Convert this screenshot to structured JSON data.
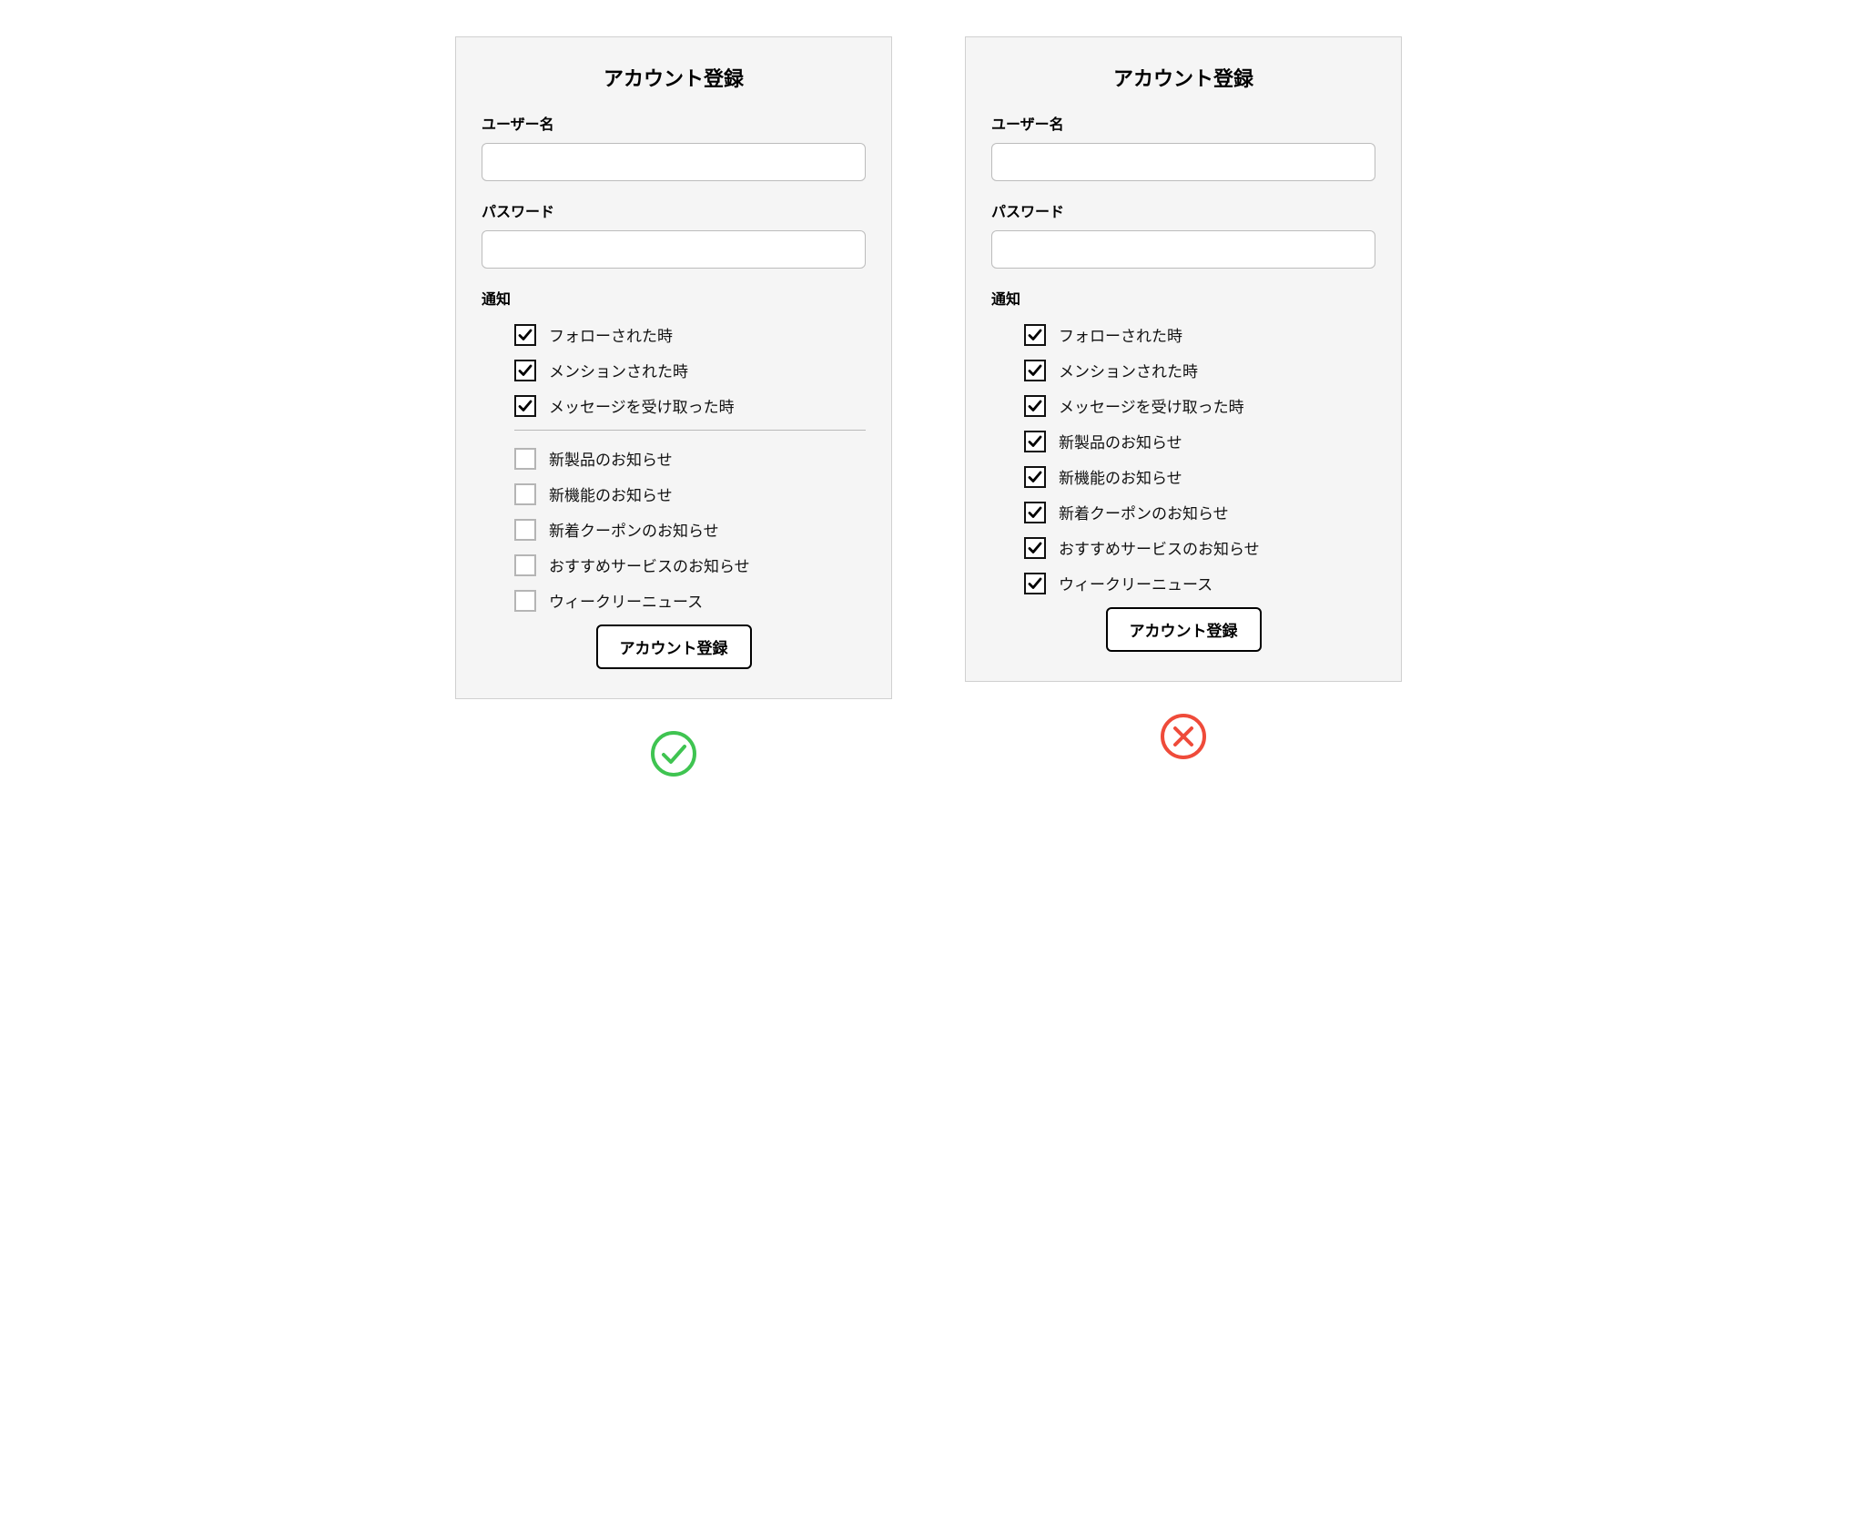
{
  "good": {
    "title": "アカウント登録",
    "username_label": "ユーザー名",
    "password_label": "パスワード",
    "notify_label": "通知",
    "group1": [
      {
        "label": "フォローされた時",
        "checked": true
      },
      {
        "label": "メンションされた時",
        "checked": true
      },
      {
        "label": "メッセージを受け取った時",
        "checked": true
      }
    ],
    "group2": [
      {
        "label": "新製品のお知らせ",
        "checked": false
      },
      {
        "label": "新機能のお知らせ",
        "checked": false
      },
      {
        "label": "新着クーポンのお知らせ",
        "checked": false
      },
      {
        "label": "おすすめサービスのお知らせ",
        "checked": false
      },
      {
        "label": "ウィークリーニュース",
        "checked": false
      }
    ],
    "submit": "アカウント登録"
  },
  "bad": {
    "title": "アカウント登録",
    "username_label": "ユーザー名",
    "password_label": "パスワード",
    "notify_label": "通知",
    "items": [
      {
        "label": "フォローされた時",
        "checked": true
      },
      {
        "label": "メンションされた時",
        "checked": true
      },
      {
        "label": "メッセージを受け取った時",
        "checked": true
      },
      {
        "label": "新製品のお知らせ",
        "checked": true
      },
      {
        "label": "新機能のお知らせ",
        "checked": true
      },
      {
        "label": "新着クーポンのお知らせ",
        "checked": true
      },
      {
        "label": "おすすめサービスのお知らせ",
        "checked": true
      },
      {
        "label": "ウィークリーニュース",
        "checked": true
      }
    ],
    "submit": "アカウント登録"
  },
  "colors": {
    "good": "#3fc451",
    "bad": "#ef4b3a"
  }
}
